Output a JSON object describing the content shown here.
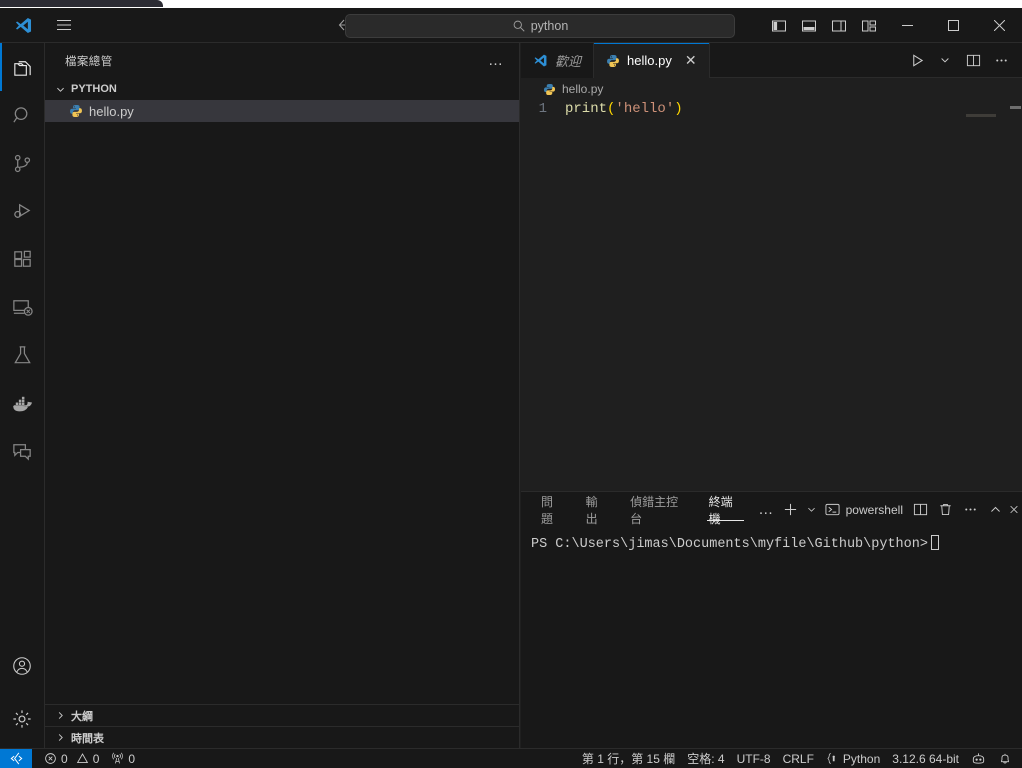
{
  "window": {
    "search_value": "python",
    "search_icon": "search-icon",
    "nav_back": "←",
    "nav_forward": "→",
    "minimize": "−",
    "maximize": "□",
    "close": "✕",
    "layout_toggles": [
      "toggle-primary-sidebar",
      "toggle-panel",
      "toggle-secondary-sidebar",
      "customize-layout"
    ]
  },
  "activitybar": {
    "items": [
      {
        "name": "explorer-icon",
        "label": "檔案總管",
        "active": true
      },
      {
        "name": "search-icon",
        "label": "搜尋",
        "active": false
      },
      {
        "name": "source-control-icon",
        "label": "原始檔控制",
        "active": false
      },
      {
        "name": "run-debug-icon",
        "label": "執行與偵錯",
        "active": false
      },
      {
        "name": "extensions-icon",
        "label": "擴充功能",
        "active": false
      },
      {
        "name": "remote-explorer-icon",
        "label": "遠端總管",
        "active": false
      },
      {
        "name": "testing-icon",
        "label": "測試",
        "active": false
      },
      {
        "name": "docker-icon",
        "label": "Docker",
        "active": false
      },
      {
        "name": "chat-icon",
        "label": "交談",
        "active": false
      }
    ],
    "bottom": [
      {
        "name": "accounts-icon",
        "label": "帳戶"
      },
      {
        "name": "settings-gear-icon",
        "label": "管理"
      }
    ]
  },
  "sidebar": {
    "title": "檔案總管",
    "more_actions": "…",
    "folder": {
      "name": "PYTHON",
      "expanded": true,
      "chevron": "⌄"
    },
    "files": [
      {
        "name": "hello.py",
        "selected": true,
        "icon": "python-file-icon"
      }
    ],
    "collapsed_sections": [
      {
        "name": "大綱",
        "chevron": "›"
      },
      {
        "name": "時間表",
        "chevron": "›"
      }
    ]
  },
  "editor": {
    "tabs": [
      {
        "label": "歡迎",
        "icon": "vscode-logo-icon",
        "active": false,
        "italic": true,
        "closable": false
      },
      {
        "label": "hello.py",
        "icon": "python-file-icon",
        "active": true,
        "italic": false,
        "closable": true,
        "close_glyph": "✕"
      }
    ],
    "actions": [
      {
        "name": "run-python-file-button",
        "glyph": "▷"
      },
      {
        "name": "run-options-chevron-icon",
        "glyph": "⌄"
      },
      {
        "name": "split-editor-right-button",
        "glyph": "split"
      },
      {
        "name": "more-editor-actions-button",
        "glyph": "…"
      }
    ],
    "breadcrumb": "hello.py",
    "breadcrumb_icon": "python-file-icon",
    "code": {
      "line_number": "1",
      "tokens": [
        {
          "text": "print",
          "type": "function"
        },
        {
          "text": "(",
          "type": "paren"
        },
        {
          "text": "'hello'",
          "type": "string"
        },
        {
          "text": ")",
          "type": "paren"
        }
      ]
    }
  },
  "panel": {
    "tabs": [
      {
        "label": "問題",
        "active": false
      },
      {
        "label": "輸出",
        "active": false
      },
      {
        "label": "偵錯主控台",
        "active": false
      },
      {
        "label": "終端機",
        "active": true
      }
    ],
    "views_more": "…",
    "new_terminal": "+",
    "new_terminal_chevron": "⌄",
    "terminal_name": "powershell",
    "terminal_icon": "terminal-powershell-icon",
    "actions": [
      {
        "name": "split-terminal-button",
        "glyph": "split"
      },
      {
        "name": "kill-terminal-button",
        "glyph": "trash"
      },
      {
        "name": "terminal-more-actions-button",
        "glyph": "…"
      },
      {
        "name": "maximize-panel-button",
        "glyph": "^"
      },
      {
        "name": "close-panel-button",
        "glyph": "✕"
      }
    ],
    "terminal_prompt": "PS C:\\Users\\jimas\\Documents\\myfile\\Github\\python>"
  },
  "statusbar": {
    "remote_icon": "remote-window-icon",
    "left_items": [
      {
        "name": "error-count",
        "icon": "error-circle-icon",
        "value": "0"
      },
      {
        "name": "warning-count",
        "icon": "warning-triangle-icon",
        "value": "0"
      },
      {
        "name": "ports-count",
        "icon": "radio-tower-icon",
        "value": "0"
      }
    ],
    "right_items": [
      {
        "name": "cursor-position",
        "label": "第 1 行，第 15 欄"
      },
      {
        "name": "indentation",
        "label": "空格: 4"
      },
      {
        "name": "encoding",
        "label": "UTF-8"
      },
      {
        "name": "eol",
        "label": "CRLF"
      },
      {
        "name": "language-mode",
        "label": "Python",
        "icon": "python-brace-icon"
      },
      {
        "name": "python-interpreter",
        "label": "3.12.6 64-bit"
      }
    ],
    "right_icons": [
      {
        "name": "copilot-icon",
        "glyph": "robot"
      },
      {
        "name": "notifications-bell-icon",
        "glyph": "bell"
      }
    ]
  },
  "colors": {
    "accent": "#0078d4",
    "bg": "#1f1f1f",
    "chrome": "#181818",
    "selection": "#37373d",
    "fn_token": "#dcdcaa",
    "paren_token": "#ffd700",
    "string_token": "#ce9178"
  }
}
